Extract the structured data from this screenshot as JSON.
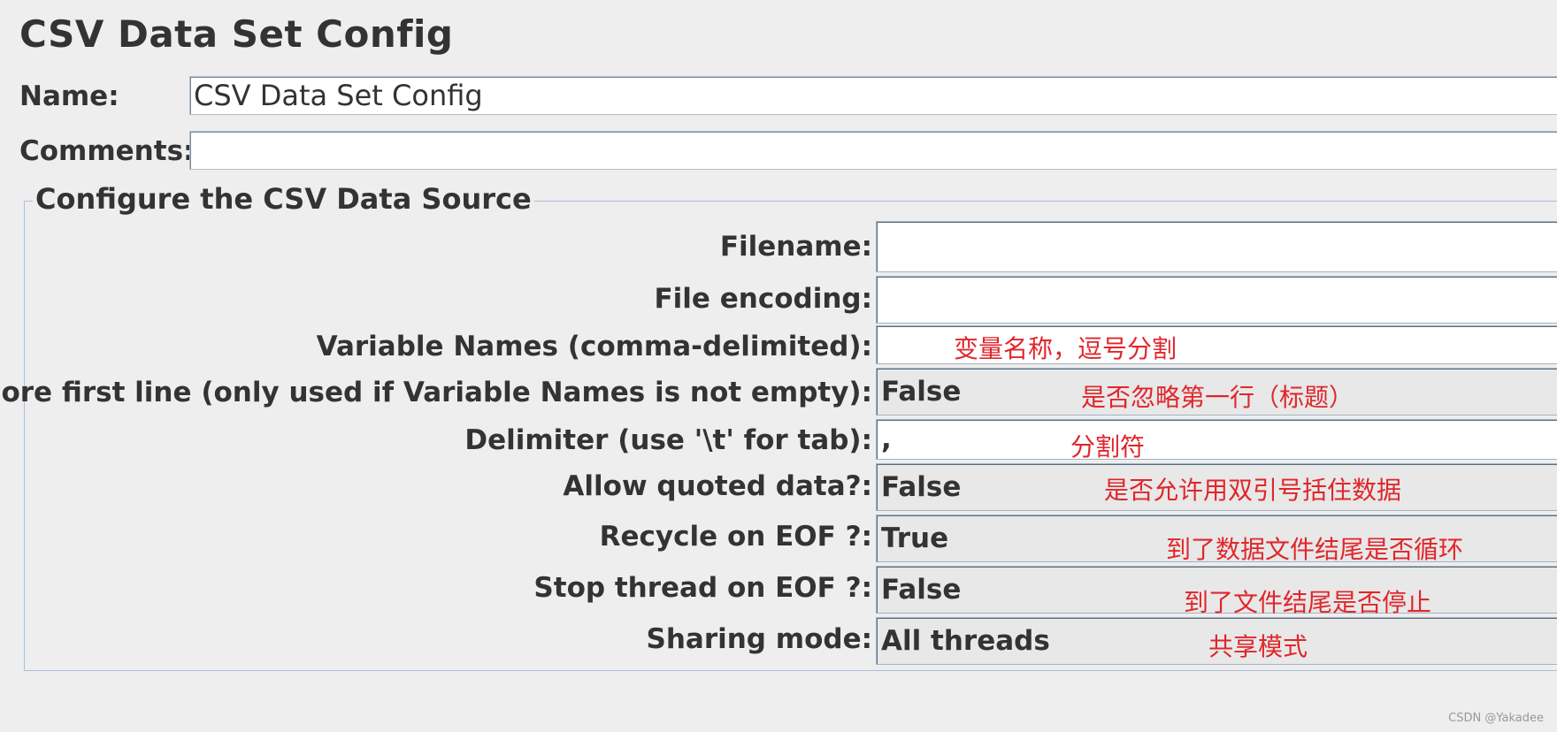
{
  "page": {
    "title": "CSV Data Set Config"
  },
  "name_row": {
    "label": "Name:",
    "value": "CSV Data Set Config"
  },
  "comments_row": {
    "label": "Comments:",
    "value": ""
  },
  "data_source": {
    "title": "Configure the CSV Data Source",
    "rows": [
      {
        "label": "Filename:",
        "value": "",
        "type": "text",
        "note": ""
      },
      {
        "label": "File encoding:",
        "value": "",
        "type": "text",
        "note": ""
      },
      {
        "label": "Variable Names (comma-delimited):",
        "value": "",
        "type": "text",
        "note": "变量名称，逗号分割"
      },
      {
        "label": "Ignore first line (only used if Variable Names is not empty):",
        "value": "False",
        "type": "combo",
        "note": "是否忽略第一行（标题）"
      },
      {
        "label": "Delimiter (use '\\t' for tab):",
        "value": ",",
        "type": "text",
        "note": "分割符"
      },
      {
        "label": "Allow quoted data?:",
        "value": "False",
        "type": "combo",
        "note": "是否允许用双引号括住数据"
      },
      {
        "label": "Recycle on EOF ?:",
        "value": "True",
        "type": "combo",
        "note": "到了数据文件结尾是否循环"
      },
      {
        "label": "Stop thread on EOF ?:",
        "value": "False",
        "type": "combo",
        "note": "到了文件结尾是否停止"
      },
      {
        "label": "Sharing mode:",
        "value": "All threads",
        "type": "combo",
        "note": "共享模式"
      }
    ]
  },
  "watermark": "CSDN @Yakadee",
  "colors": {
    "background": "#eeeeee",
    "annotation": "#e0262b",
    "group_border": "#a9c1dc",
    "text": "#333333"
  }
}
